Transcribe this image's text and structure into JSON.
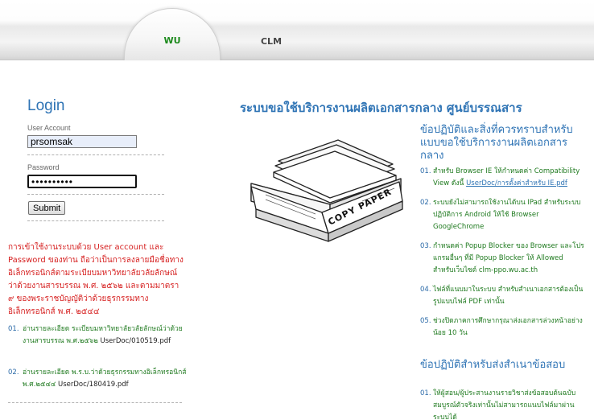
{
  "nav": {
    "tabs": [
      {
        "label": "WU",
        "active": true
      },
      {
        "label": "CLM",
        "active": false
      }
    ],
    "active_color": "#1c8a1c"
  },
  "login": {
    "title": "Login",
    "user_label": "User Account",
    "user_value": "prsomsak",
    "password_label": "Password",
    "password_value": "••••••••••",
    "submit_label": "Submit"
  },
  "notice": {
    "text": "การเข้าใช้งานระบบด้วย User account และ Password ของท่าน ถือว่าเป็นการลงลายมือชื่อทางอิเล็กทรอนิกส์ตามระเบียบมหาวิทยาลัยวลัยลักษณ์ ว่าด้วยงานสารบรรณ พ.ศ. ๒๕๖๒ และตามมาตรา ๙ ของพระราชบัญญัติว่าด้วยธุรกรรมทางอิเล็กทรอนิกส์ พ.ศ. ๒๕๔๔",
    "color": "#d62020"
  },
  "documents": [
    {
      "num": "01.",
      "text": "อ่านรายละเอียด ระเบียบมหาวิทยาลัยวลัยลักษณ์ว่าด้วยงานสารบรรณ พ.ศ.๒๕๖๒",
      "link": "UserDoc/010519.pdf"
    },
    {
      "num": "02.",
      "text": "อ่านรายละเอียด พ.ร.บ.ว่าด้วยธุรกรรมทางอิเล็กทรอนิกส์ พ.ศ.๒๕๔๔",
      "link": "UserDoc/180419.pdf"
    }
  ],
  "main": {
    "title": "ระบบขอใช้บริการงานผลิตเอกสารกลาง ศูนย์บรรณสาร",
    "illustration_text": "COPY PAPER",
    "section1": {
      "title": "ข้อปฏิบัติและสิ่งที่ควรทราบสำหรับแบบขอใช้บริการงานผลิตเอกสารกลาง",
      "items": [
        {
          "num": "01.",
          "text": "สำหรับ Browser IE ให้กำหนดค่า Compatibility View ดังนี้",
          "link": "UserDoc/การตั้งค่าสำหรับ IE.pdf"
        },
        {
          "num": "02.",
          "text": "ระบบยังไม่สามารถใช้งานได้บน IPad สำหรับระบบปฏิบัติการ Android ให้ใช้ Browser GoogleChrome",
          "link": ""
        },
        {
          "num": "03.",
          "text": "กำหนดค่า Popup Blocker ของ Browser และโปรแกรมอื่นๆ ที่มี Popup Blocker ให้ Allowed สำหรับเว็บไซต์ clm-ppo.wu.ac.th",
          "link": ""
        },
        {
          "num": "04.",
          "text": "ไฟล์ที่แนบมาในระบบ สำหรับสำเนาเอกสารต้องเป็นรูปแบบไฟล์ PDF เท่านั้น",
          "link": ""
        },
        {
          "num": "05.",
          "text": "ช่วงปิดภาคการศึกษากรุณาส่งเอกสารล่วงหน้าอย่างน้อย 10 วัน",
          "link": ""
        }
      ]
    },
    "section2": {
      "title": "ข้อปฏิบัติสำหรับส่งสำเนาข้อสอบ",
      "items": [
        {
          "num": "01.",
          "text": "ให้ผู้สอน/ผู้ประสานงานรายวิชาส่งข้อสอบต้นฉบับสมบูรณ์ตัวจริงเท่านั้นไม่สามารถแนบไฟล์มาผ่านระบบได้",
          "link": ""
        }
      ]
    },
    "accent_color": "#2f74b5",
    "text_color": "#1f7a1f"
  }
}
